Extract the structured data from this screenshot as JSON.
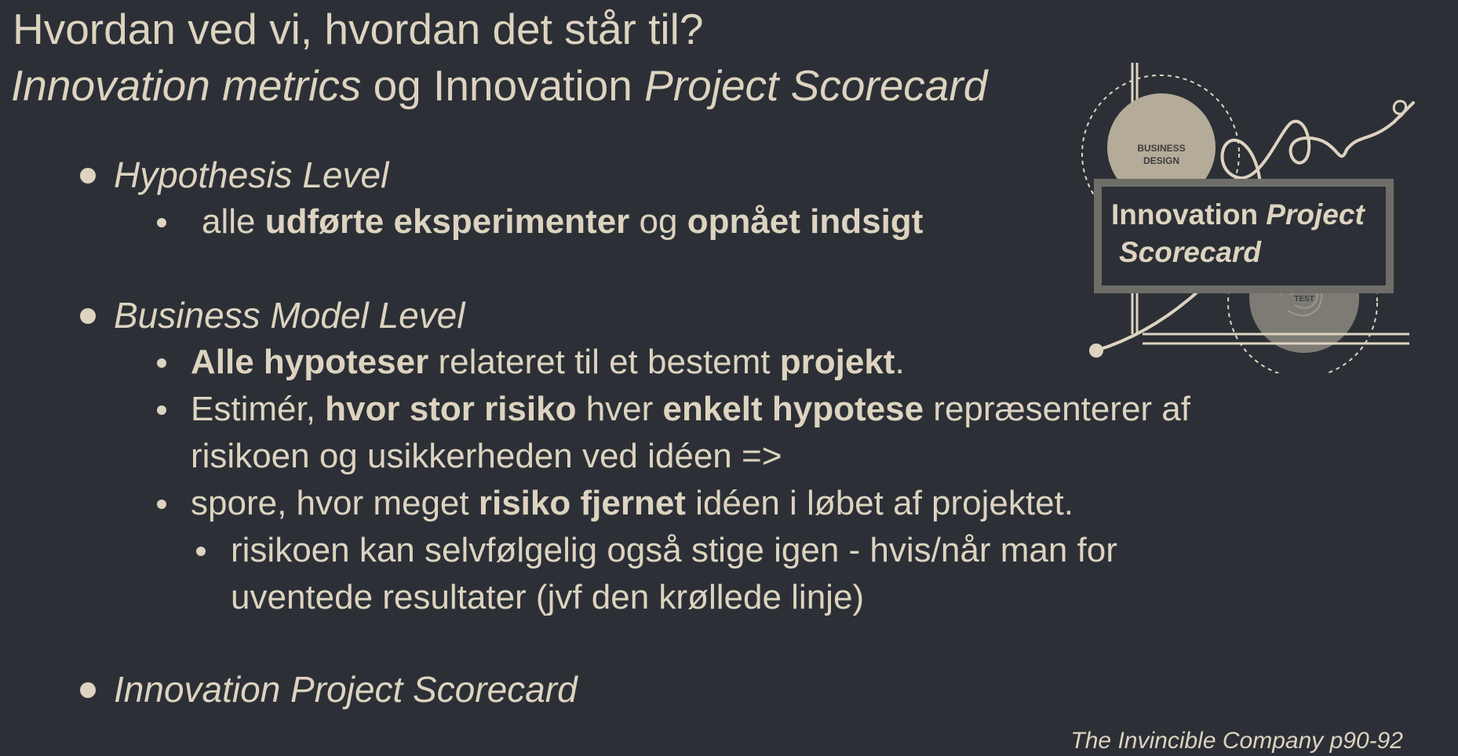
{
  "title": {
    "line1": "Hvordan ved vi, hvordan det står til?",
    "line2_part1": "Innovation metrics",
    "line2_part2": " og Innovation ",
    "line2_part3": "Project Scorecard"
  },
  "bullets": {
    "hypothesis_level": {
      "heading": "Hypothesis Level",
      "sub1": {
        "t1": "alle ",
        "b1": "udførte eksperimenter",
        "t2": " og ",
        "b2": "opnået indsigt"
      }
    },
    "business_model_level": {
      "heading": "Business Model Level",
      "sub1": {
        "b1": "Alle hypoteser",
        "t1": " relateret til et bestemt ",
        "b2": "projekt",
        "t2": "."
      },
      "sub2": {
        "t1": "Estimér, ",
        "b1": "hvor stor risiko",
        "t2": " hver ",
        "b2": "enkelt hypotese",
        "t3": " repræsenterer af",
        "line2": "risikoen og usikkerheden ved idéen =>"
      },
      "sub3": {
        "t1": "spore, hvor meget ",
        "b1": "risiko fjernet",
        "t2": " idéen i løbet af projektet."
      },
      "sub3_child": {
        "line1": "risikoen kan selvfølgelig også stige igen - hvis/når man for",
        "line2": "uventede resultater (jvf den krøllede linje)"
      }
    },
    "innovation_project_scorecard": {
      "heading": "Innovation Project Scorecard"
    }
  },
  "figure": {
    "circle_label_line1": "BUSINESS",
    "circle_label_line2": "DESIGN",
    "test_label": "TEST",
    "box_line1_regular": "Innovation ",
    "box_line1_italic": "Project",
    "box_line2_italic": "Scorecard"
  },
  "citation": "The Invincible Company p90-92",
  "colors": {
    "background": "#2c3036",
    "text": "#ddd3c0",
    "box_border": "#6e6d67"
  }
}
